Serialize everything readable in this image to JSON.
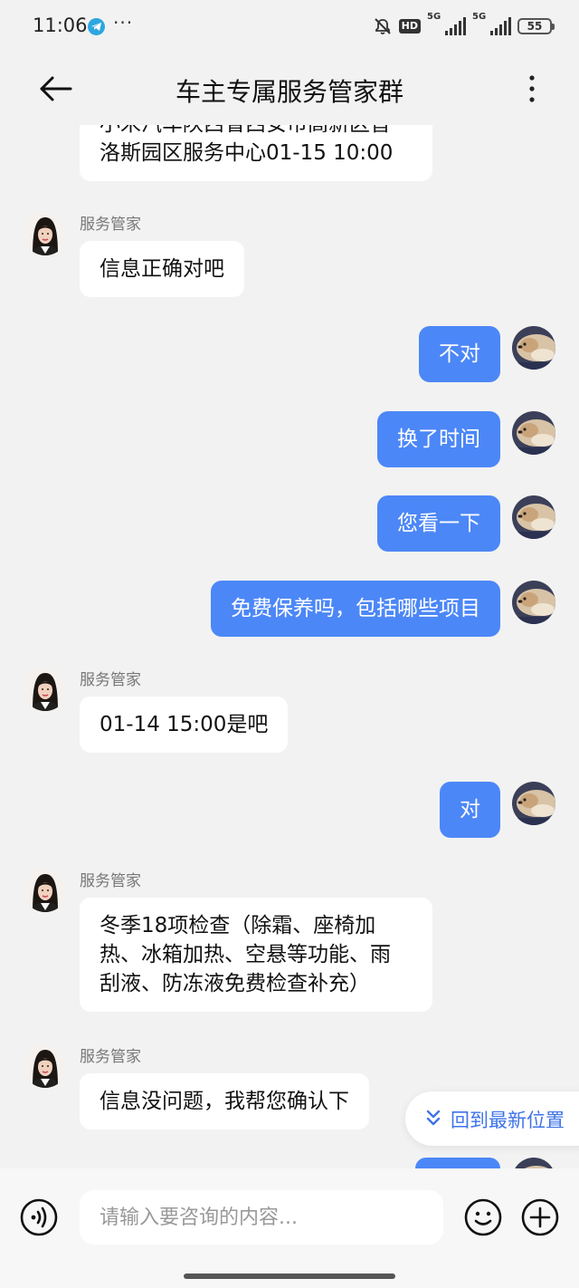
{
  "status_bar": {
    "time": "11:06",
    "more": "···",
    "hd": "HD",
    "net1": "5G",
    "net2": "5G",
    "battery": "55"
  },
  "header": {
    "title": "车主专属服务管家群"
  },
  "messages": [
    {
      "side": "in",
      "lines": [
        "小米汽车陕西省西安市高新区普",
        "洛斯园区服务中心01-15 10:00"
      ],
      "partial": true
    },
    {
      "side": "in",
      "sender": "服务管家",
      "text": "信息正确对吧"
    },
    {
      "side": "out",
      "text": "不对"
    },
    {
      "side": "out",
      "text": "换了时间"
    },
    {
      "side": "out",
      "text": "您看一下"
    },
    {
      "side": "out",
      "text": "免费保养吗，包括哪些项目"
    },
    {
      "side": "in",
      "sender": "服务管家",
      "text": "01-14 15:00是吧"
    },
    {
      "side": "out",
      "text": "对"
    },
    {
      "side": "in",
      "sender": "服务管家",
      "lines": [
        "冬季18项检查（除霜、座椅加",
        "热、冰箱加热、空悬等功能、雨",
        "刮液、防冻液免费检查补充）"
      ]
    },
    {
      "side": "in",
      "sender": "服务管家",
      "text": "信息没问题，我帮您确认下"
    }
  ],
  "jump_to_latest": "回到最新位置",
  "input": {
    "placeholder": "请输入要咨询的内容..."
  },
  "colors": {
    "outgoing_bubble": "#4c87f7",
    "incoming_bubble": "#ffffff",
    "background": "#f2f2f2",
    "accent_text": "#3f73e8"
  },
  "icons": [
    "back-arrow-icon",
    "more-vertical-icon",
    "voice-icon",
    "emoji-icon",
    "plus-icon",
    "chevron-double-down-icon",
    "mute-icon",
    "telegram-icon"
  ]
}
